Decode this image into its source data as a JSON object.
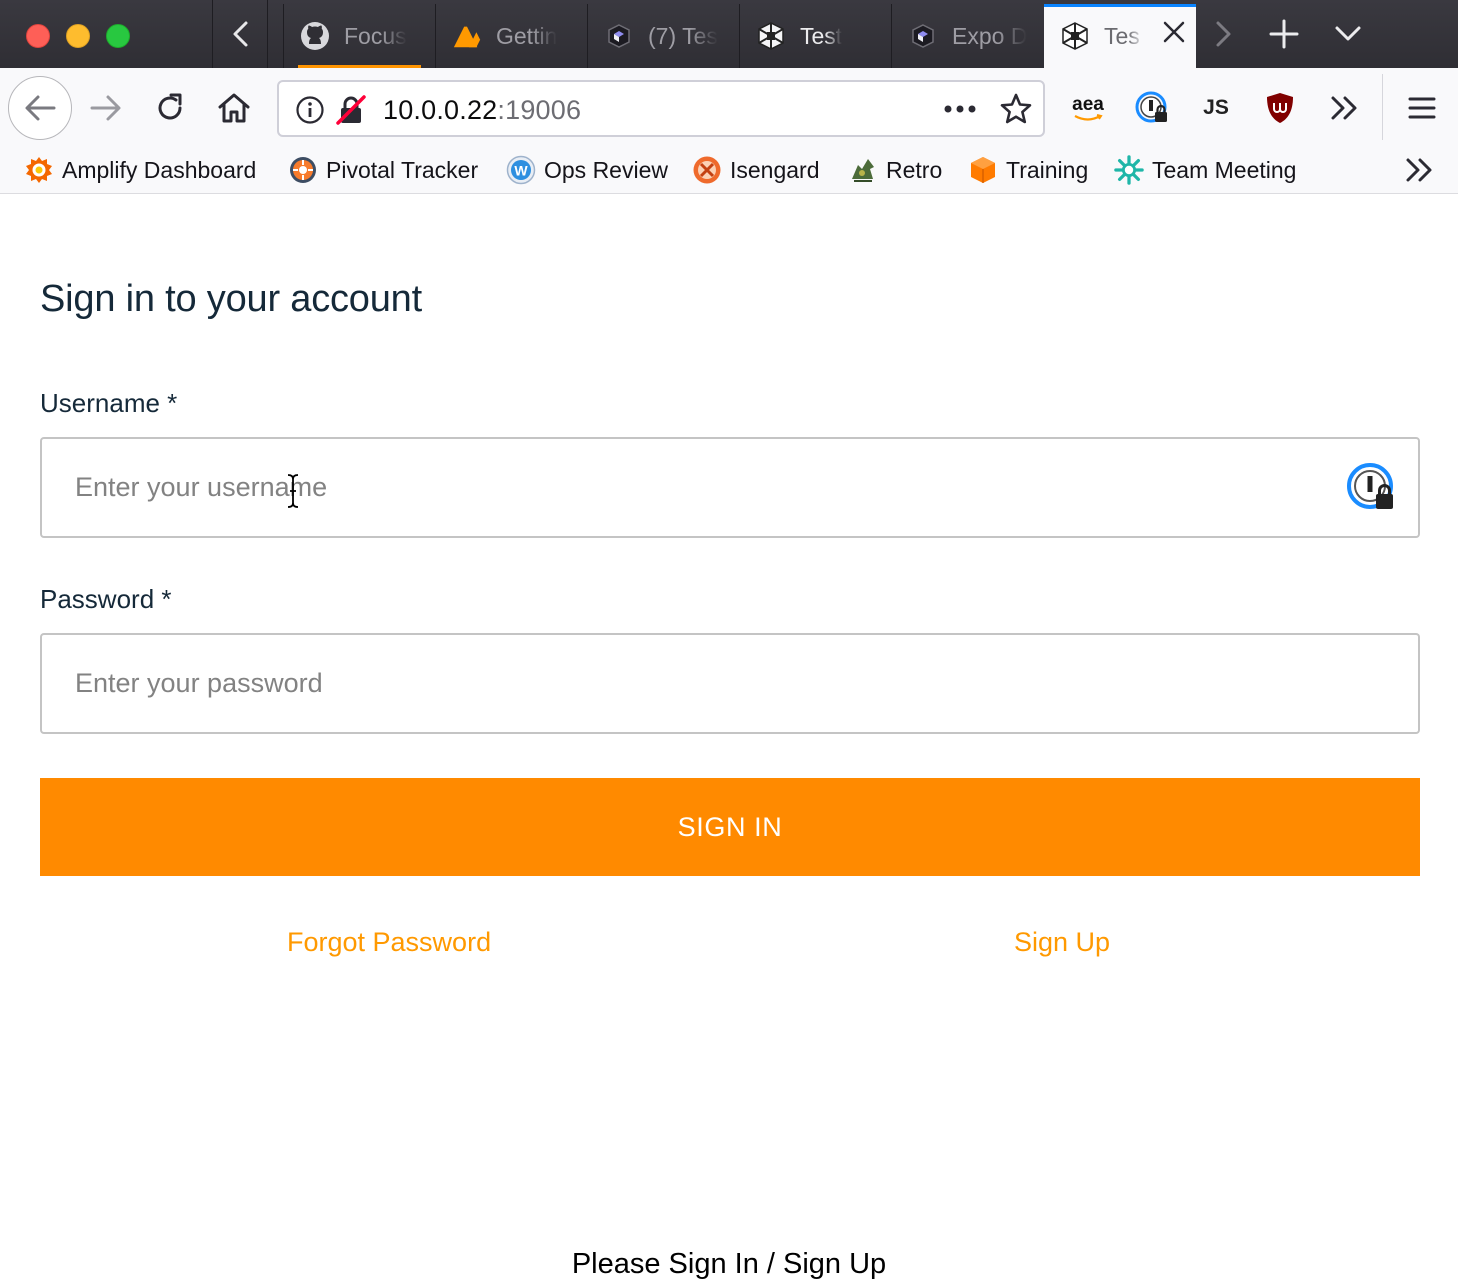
{
  "browser": {
    "tabs": [
      {
        "label": "Focus",
        "icon": "github-icon"
      },
      {
        "label": "Gettin",
        "icon": "amplify-icon"
      },
      {
        "label": "(7) Tes",
        "icon": "cube-icon"
      },
      {
        "label": "Test",
        "icon": "snack-icon"
      },
      {
        "label": "Expo D",
        "icon": "cube-icon"
      },
      {
        "label": "Tes",
        "icon": "snack-icon"
      }
    ],
    "url_host": "10.0.0.22",
    "url_port": ":19006",
    "extensions": {
      "aea_label": "aea",
      "js_label": "JS"
    },
    "bookmarks": [
      {
        "label": "Amplify Dashboard",
        "icon": "grafana-icon"
      },
      {
        "label": "Pivotal Tracker",
        "icon": "pivotal-icon"
      },
      {
        "label": "Ops Review",
        "icon": "wiki-icon"
      },
      {
        "label": "Isengard",
        "icon": "isengard-icon"
      },
      {
        "label": "Retro",
        "icon": "retro-icon"
      },
      {
        "label": "Training",
        "icon": "training-icon"
      },
      {
        "label": "Team Meeting",
        "icon": "team-meeting-icon"
      }
    ]
  },
  "page": {
    "title": "Sign in to your account",
    "username": {
      "label": "Username *",
      "placeholder": "Enter your username",
      "value": ""
    },
    "password": {
      "label": "Password *",
      "placeholder": "Enter your password",
      "value": ""
    },
    "sign_in_label": "SIGN IN",
    "forgot_password_label": "Forgot Password",
    "sign_up_label": "Sign Up",
    "footer": "Please Sign In / Sign Up"
  },
  "colors": {
    "accent": "#ff8a00",
    "link": "#ff9900",
    "heading": "#152939"
  }
}
